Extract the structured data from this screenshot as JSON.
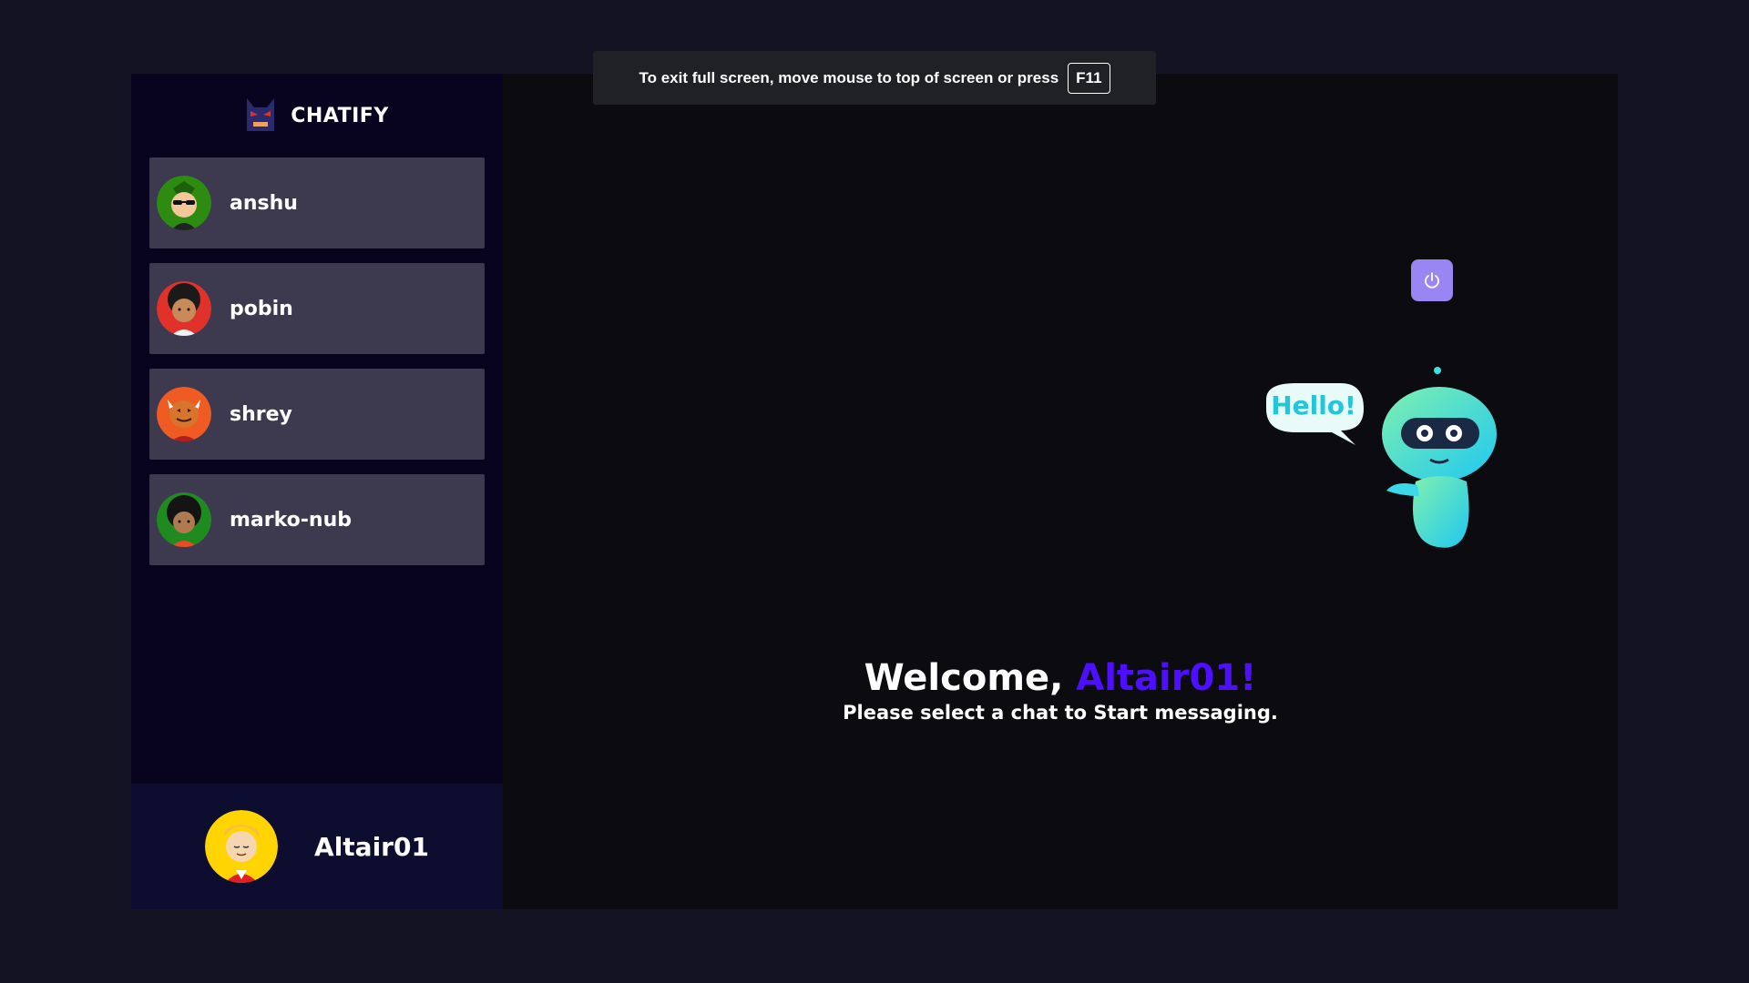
{
  "app": {
    "brand_name": "CHATIFY",
    "brand_logo_icon": "masked-face-logo-icon"
  },
  "contacts": [
    {
      "name": "anshu",
      "avatar_icon": "avatar-sunglasses-icon",
      "avatar_color": "#2e8b12"
    },
    {
      "name": "pobin",
      "avatar_icon": "avatar-curly-hair-icon",
      "avatar_color": "#e0322b"
    },
    {
      "name": "shrey",
      "avatar_icon": "avatar-pumpkin-icon",
      "avatar_color": "#f05a23"
    },
    {
      "name": "marko-nub",
      "avatar_icon": "avatar-afro-icon",
      "avatar_color": "#1f8a1f"
    }
  ],
  "current_user": {
    "name": "Altair01",
    "avatar_icon": "avatar-blond-icon",
    "avatar_color": "#ffd400"
  },
  "main": {
    "logout_icon": "power-icon",
    "robot_bubble_text": "Hello!",
    "welcome_prefix": "Welcome, ",
    "welcome_user": "Altair01!",
    "welcome_sub": "Please select a chat to Start messaging."
  },
  "fullscreen_notice": {
    "message": "To exit full screen, move mouse to top of screen or press",
    "key": "F11"
  },
  "colors": {
    "page_bg": "#131324",
    "sidebar_bg": "#080420",
    "contact_bg": "#3d3a4f",
    "current_user_bg": "#0d0d30",
    "accent": "#4e0eff",
    "logout_button": "#9a86f3"
  }
}
